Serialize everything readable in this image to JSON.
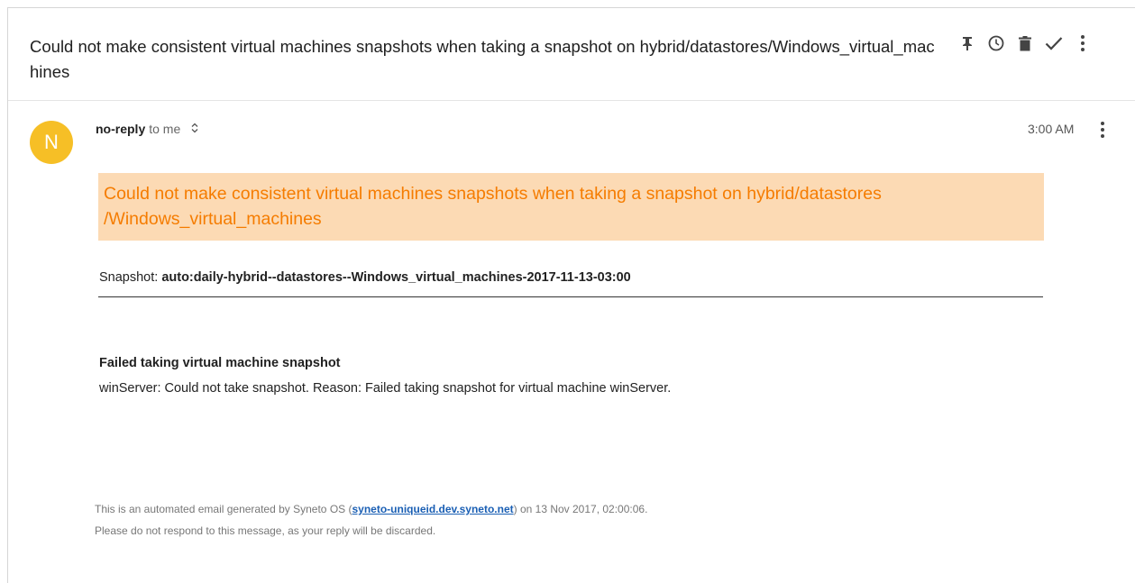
{
  "email": {
    "subject": "Could not make consistent virtual machines snapshots when taking a snapshot on hybrid/datastores/Windows_virtual_machines",
    "toolbar": {
      "icons": [
        "pin-icon",
        "snooze-icon",
        "delete-icon",
        "done-icon",
        "more-vert-icon"
      ]
    },
    "sender": {
      "avatar_letter": "N",
      "avatar_color": "#f6bf26",
      "name": "no-reply",
      "to": "to me",
      "expand_glyph": "⌃⌄"
    },
    "time": "3:00 AM",
    "body": {
      "banner_text": "Could not make consistent virtual machines snapshots when taking a snapshot on hybrid/datastores /Windows_virtual_machines",
      "banner_bg": "#fcdab4",
      "banner_color": "#f57c00",
      "snapshot_label": "Snapshot: ",
      "snapshot_value": "auto:daily-hybrid--datastores--Windows_virtual_machines-2017-11-13-03:00",
      "failure_title": "Failed taking virtual machine snapshot",
      "failure_message": "winServer: Could not take snapshot. Reason: Failed taking snapshot for virtual machine winServer."
    },
    "footer": {
      "line1_prefix": "This is an automated email generated by Syneto OS (",
      "link_text": "syneto-uniqueid.dev.syneto.net",
      "line1_suffix": ") on 13 Nov 2017, 02:00:06.",
      "line2": "Please do not respond to this message, as your reply will be discarded."
    }
  }
}
